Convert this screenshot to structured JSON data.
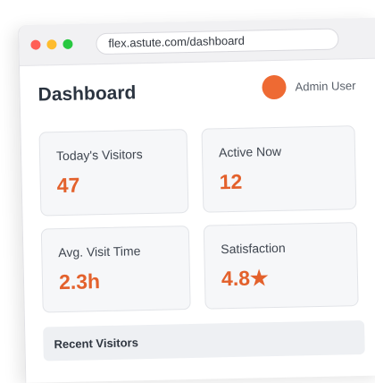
{
  "browser": {
    "url": "flex.astute.com/dashboard"
  },
  "header": {
    "title": "Dashboard",
    "user_name": "Admin User"
  },
  "stats": [
    {
      "label": "Today's Visitors",
      "value": "47"
    },
    {
      "label": "Active Now",
      "value": "12"
    },
    {
      "label": "Avg. Visit Time",
      "value": "2.3h"
    },
    {
      "label": "Satisfaction",
      "value": "4.8★"
    }
  ],
  "recent": {
    "title": "Recent Visitors"
  },
  "colors": {
    "accent": "#e3612c",
    "avatar": "#ee6a33",
    "card_bg": "#f6f7f9"
  }
}
